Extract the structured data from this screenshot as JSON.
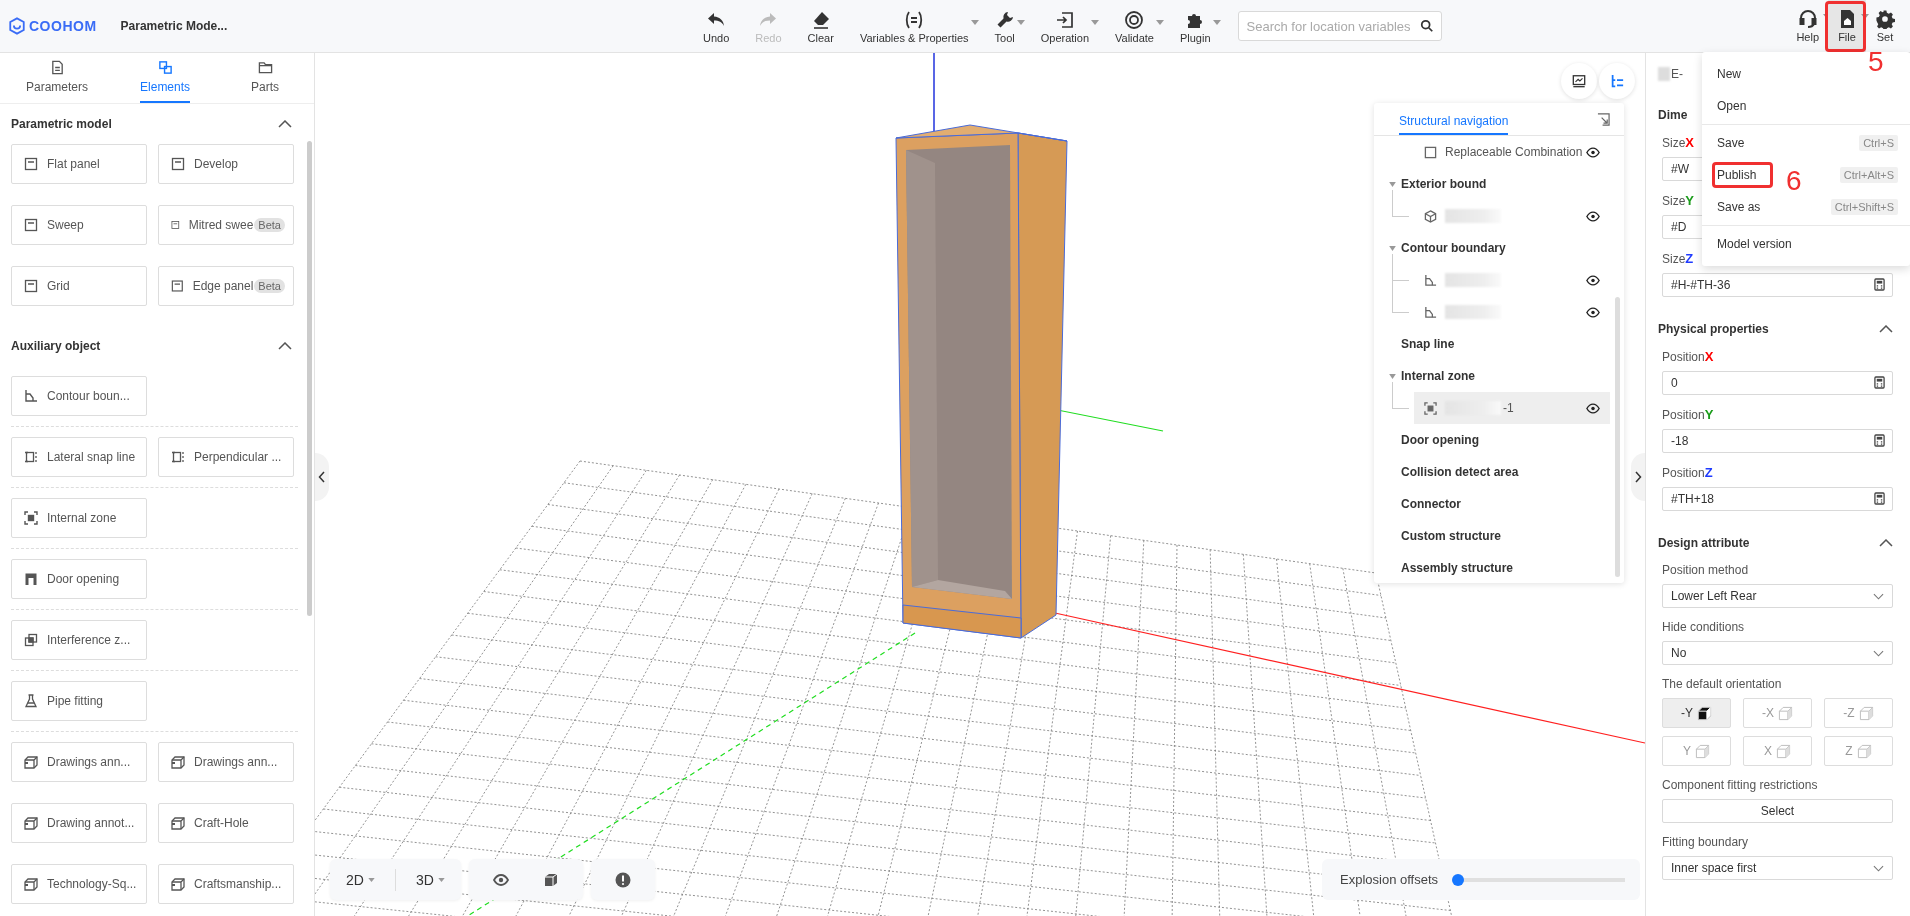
{
  "app": {
    "logo": "COOHOM",
    "title": "Parametric Mode..."
  },
  "toolbar": [
    {
      "label": "Undo",
      "kind": "undo",
      "disabled": false,
      "dropdown": false
    },
    {
      "label": "Redo",
      "kind": "redo",
      "disabled": true,
      "dropdown": false
    },
    {
      "label": "Clear",
      "kind": "clear",
      "disabled": false,
      "dropdown": false
    },
    {
      "label": "Variables & Properties",
      "kind": "variables",
      "disabled": false,
      "dropdown": true
    },
    {
      "label": "Tool",
      "kind": "tool",
      "disabled": false,
      "dropdown": true
    },
    {
      "label": "Operation",
      "kind": "operation",
      "disabled": false,
      "dropdown": true
    },
    {
      "label": "Validate",
      "kind": "validate",
      "disabled": false,
      "dropdown": true
    },
    {
      "label": "Plugin",
      "kind": "plugin",
      "disabled": false,
      "dropdown": true
    }
  ],
  "search": {
    "placeholder": "Search for location variables"
  },
  "right_tools": [
    {
      "label": "Help",
      "kind": "help",
      "dropdown": true,
      "selected": false
    },
    {
      "label": "File",
      "kind": "file",
      "dropdown": true,
      "selected": true,
      "annotation": "5"
    },
    {
      "label": "Set",
      "kind": "settings",
      "dropdown": false,
      "selected": false
    }
  ],
  "file_menu": {
    "groups": [
      [
        {
          "label": "New"
        },
        {
          "label": "Open"
        }
      ],
      [
        {
          "label": "Save",
          "shortcut": "Ctrl+S"
        },
        {
          "label": "Publish",
          "shortcut": "Ctrl+Alt+S",
          "annotation": "6"
        },
        {
          "label": "Save as",
          "shortcut": "Ctrl+Shift+S"
        }
      ],
      [
        {
          "label": "Model version"
        }
      ]
    ]
  },
  "sidebar": {
    "tabs": [
      {
        "label": "Parameters",
        "kind": "parameters",
        "selected": false
      },
      {
        "label": "Elements",
        "kind": "elements",
        "selected": true
      },
      {
        "label": "Parts",
        "kind": "parts",
        "selected": false
      }
    ],
    "sections": [
      {
        "title": "Parametric model",
        "expanded": true,
        "groups": [
          {
            "items": [
              {
                "label": "Flat panel",
                "kind": "panel"
              },
              {
                "label": "Develop",
                "kind": "panel"
              },
              {
                "label": "Sweep",
                "kind": "panel"
              },
              {
                "label": "Mitred swee",
                "kind": "panel",
                "badge": "Beta"
              },
              {
                "label": "Grid",
                "kind": "panel"
              },
              {
                "label": "Edge panel",
                "kind": "panel",
                "badge": "Beta"
              }
            ]
          }
        ]
      },
      {
        "title": "Auxiliary object",
        "expanded": true,
        "groups": [
          {
            "items": [
              {
                "label": "Contour boun...",
                "kind": "contour"
              }
            ]
          },
          {
            "items": [
              {
                "label": "Lateral snap line",
                "kind": "snap"
              },
              {
                "label": "Perpendicular ...",
                "kind": "snap"
              }
            ]
          },
          {
            "items": [
              {
                "label": "Internal zone",
                "kind": "zone"
              }
            ]
          },
          {
            "items": [
              {
                "label": "Door opening",
                "kind": "door"
              }
            ]
          },
          {
            "items": [
              {
                "label": "Interference z...",
                "kind": "interference"
              }
            ]
          },
          {
            "items": [
              {
                "label": "Pipe fitting",
                "kind": "pipe"
              }
            ]
          },
          {
            "items": [
              {
                "label": "Drawings ann...",
                "kind": "annotation"
              },
              {
                "label": "Drawings ann...",
                "kind": "annotation"
              },
              {
                "label": "Drawing annot...",
                "kind": "annotation"
              },
              {
                "label": "Craft-Hole",
                "kind": "annotation"
              },
              {
                "label": "Technology-Sq...",
                "kind": "annotation"
              },
              {
                "label": "Craftsmanship...",
                "kind": "annotation"
              }
            ]
          }
        ]
      }
    ]
  },
  "viewport": {
    "nav_panel": {
      "tab": "Structural navigation",
      "items": [
        {
          "kind": "entry",
          "label": "Replaceable Combination",
          "visible": true,
          "selected": false
        },
        {
          "kind": "group",
          "label": "Exterior bound",
          "expanded": true,
          "children": [
            {
              "kind": "solid",
              "redacted": true,
              "visible": true,
              "selected": false
            }
          ]
        },
        {
          "kind": "group",
          "label": "Contour boundary",
          "expanded": true,
          "children": [
            {
              "kind": "contour",
              "redacted": true,
              "visible": true,
              "selected": false
            },
            {
              "kind": "contour",
              "redacted": true,
              "visible": true,
              "selected": false
            }
          ]
        },
        {
          "kind": "group",
          "label": "Snap line",
          "expanded": false
        },
        {
          "kind": "group",
          "label": "Internal zone",
          "expanded": true,
          "children": [
            {
              "kind": "zone",
              "label": "-1",
              "redacted": true,
              "visible": true,
              "selected": true
            }
          ]
        },
        {
          "kind": "group",
          "label": "Door opening",
          "expanded": false
        },
        {
          "kind": "group",
          "label": "Collision detect area",
          "expanded": false
        },
        {
          "kind": "group",
          "label": "Connector",
          "expanded": false
        },
        {
          "kind": "group",
          "label": "Custom structure",
          "expanded": false
        },
        {
          "kind": "group",
          "label": "Assembly structure",
          "expanded": false
        }
      ]
    },
    "view_modes": [
      {
        "label": "2D"
      },
      {
        "label": "3D"
      }
    ],
    "explosion": {
      "label": "Explosion offsets",
      "level": 0.0
    }
  },
  "properties": {
    "header": "E-",
    "sections": [
      {
        "title": "Dime",
        "fields": [
          {
            "kind": "input",
            "label": "Size",
            "axis": "X",
            "color": "#ff0000",
            "value": "#W"
          },
          {
            "kind": "input",
            "label": "Size",
            "axis": "Y",
            "color": "#1a9c1a",
            "value": "#D"
          },
          {
            "kind": "input",
            "label": "Size",
            "axis": "Z",
            "color": "#1f3bff",
            "value": "#H-#TH-36"
          }
        ]
      },
      {
        "title": "Physical properties",
        "expanded": true,
        "fields": [
          {
            "kind": "input",
            "label": "Position",
            "axis": "X",
            "color": "#ff0000",
            "value": "0"
          },
          {
            "kind": "input",
            "label": "Position",
            "axis": "Y",
            "color": "#1a9c1a",
            "value": "-18"
          },
          {
            "kind": "input",
            "label": "Position",
            "axis": "Z",
            "color": "#1f3bff",
            "value": "#TH+18"
          }
        ]
      },
      {
        "title": "Design attribute",
        "expanded": true,
        "fields": [
          {
            "kind": "select",
            "label": "Position method",
            "value": "Lower Left Rear"
          },
          {
            "kind": "select",
            "label": "Hide conditions",
            "value": "No"
          },
          {
            "kind": "orientation",
            "label": "The default orientation",
            "options": [
              {
                "label": "-Y",
                "selected": true
              },
              {
                "label": "-X",
                "selected": false
              },
              {
                "label": "-Z",
                "selected": false
              },
              {
                "label": "Y",
                "selected": false
              },
              {
                "label": "X",
                "selected": false
              },
              {
                "label": "Z",
                "selected": false
              }
            ]
          },
          {
            "kind": "button",
            "label": "Component fitting restrictions",
            "button": "Select"
          },
          {
            "kind": "select",
            "label": "Fitting boundary",
            "value": "Inner space first"
          }
        ]
      }
    ]
  }
}
